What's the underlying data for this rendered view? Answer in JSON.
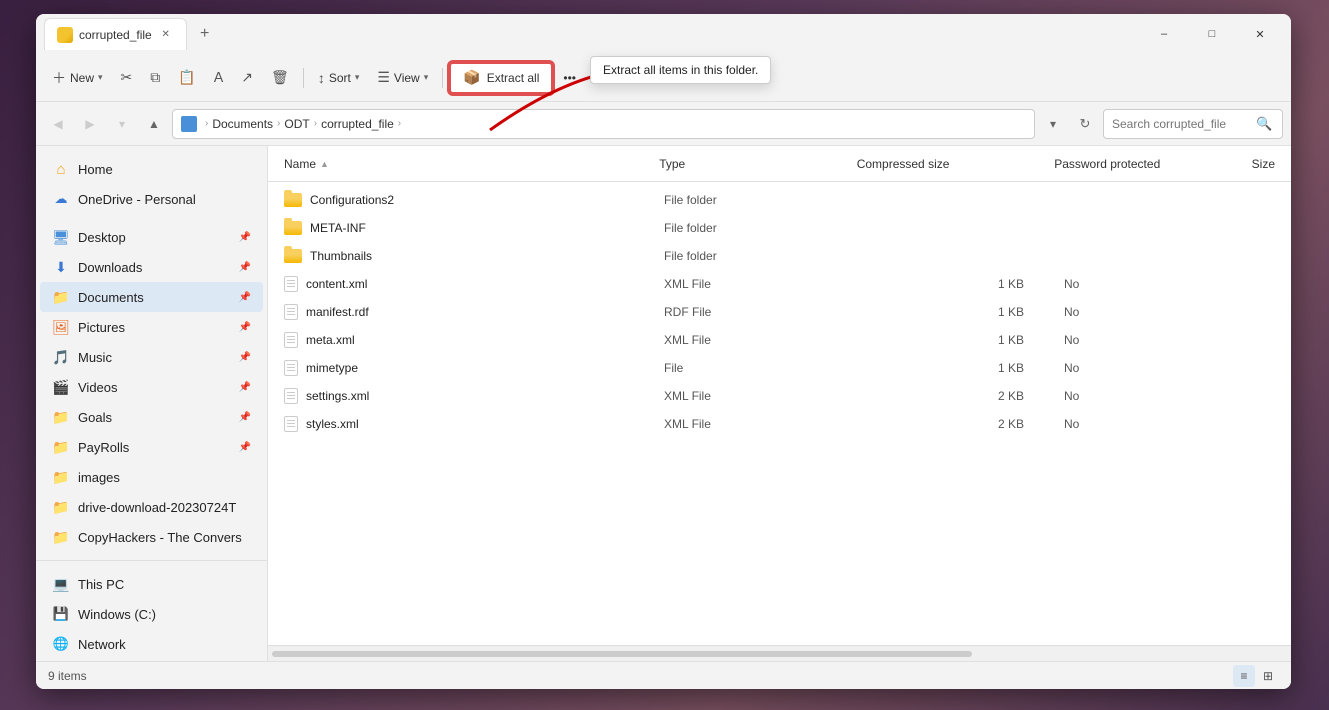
{
  "window": {
    "title": "corrupted_file",
    "tab_label": "corrupted_file"
  },
  "toolbar": {
    "new_label": "New",
    "sort_label": "Sort",
    "view_label": "View",
    "extract_all_label": "Extract all",
    "extract_all_tooltip": "Extract all items in this folder."
  },
  "addressbar": {
    "path_segments": [
      "Documents",
      "ODT",
      "corrupted_file"
    ],
    "search_placeholder": "Search corrupted_file"
  },
  "sidebar": {
    "items": [
      {
        "label": "Home",
        "icon": "home-icon",
        "active": false
      },
      {
        "label": "OneDrive - Personal",
        "icon": "cloud-icon",
        "active": false
      },
      {
        "label": "Desktop",
        "icon": "desktop-icon",
        "active": false,
        "pinned": true
      },
      {
        "label": "Downloads",
        "icon": "downloads-icon",
        "active": false,
        "pinned": true
      },
      {
        "label": "Documents",
        "icon": "documents-icon",
        "active": true,
        "pinned": true
      },
      {
        "label": "Pictures",
        "icon": "pictures-icon",
        "active": false,
        "pinned": true
      },
      {
        "label": "Music",
        "icon": "music-icon",
        "active": false,
        "pinned": true
      },
      {
        "label": "Videos",
        "icon": "videos-icon",
        "active": false,
        "pinned": true
      },
      {
        "label": "Goals",
        "icon": "folder-icon",
        "active": false,
        "pinned": true
      },
      {
        "label": "PayRolls",
        "icon": "folder-icon",
        "active": false,
        "pinned": true
      },
      {
        "label": "images",
        "icon": "folder-icon",
        "active": false,
        "pinned": false
      },
      {
        "label": "drive-download-20230724T",
        "icon": "folder-icon",
        "active": false,
        "pinned": false
      },
      {
        "label": "CopyHackers - The Convers",
        "icon": "folder-icon",
        "active": false,
        "pinned": false
      },
      {
        "label": "This PC",
        "icon": "pc-icon",
        "active": false
      },
      {
        "label": "Windows (C:)",
        "icon": "drive-icon",
        "active": false
      },
      {
        "label": "Network",
        "icon": "network-icon",
        "active": false
      }
    ]
  },
  "file_list": {
    "columns": {
      "name": "Name",
      "type": "Type",
      "compressed_size": "Compressed size",
      "password_protected": "Password protected",
      "size": "Size"
    },
    "files": [
      {
        "name": "Configurations2",
        "type": "File folder",
        "compressed_size": "",
        "password_protected": "",
        "size": "",
        "is_folder": true
      },
      {
        "name": "META-INF",
        "type": "File folder",
        "compressed_size": "",
        "password_protected": "",
        "size": "",
        "is_folder": true
      },
      {
        "name": "Thumbnails",
        "type": "File folder",
        "compressed_size": "",
        "password_protected": "",
        "size": "",
        "is_folder": true
      },
      {
        "name": "content.xml",
        "type": "XML File",
        "compressed_size": "1 KB",
        "password_protected": "No",
        "size": "",
        "is_folder": false
      },
      {
        "name": "manifest.rdf",
        "type": "RDF File",
        "compressed_size": "1 KB",
        "password_protected": "No",
        "size": "",
        "is_folder": false
      },
      {
        "name": "meta.xml",
        "type": "XML File",
        "compressed_size": "1 KB",
        "password_protected": "No",
        "size": "",
        "is_folder": false
      },
      {
        "name": "mimetype",
        "type": "File",
        "compressed_size": "1 KB",
        "password_protected": "No",
        "size": "",
        "is_folder": false
      },
      {
        "name": "settings.xml",
        "type": "XML File",
        "compressed_size": "2 KB",
        "password_protected": "No",
        "size": "",
        "is_folder": false
      },
      {
        "name": "styles.xml",
        "type": "XML File",
        "compressed_size": "2 KB",
        "password_protected": "No",
        "size": "",
        "is_folder": false
      }
    ]
  },
  "status_bar": {
    "item_count": "9 items"
  }
}
